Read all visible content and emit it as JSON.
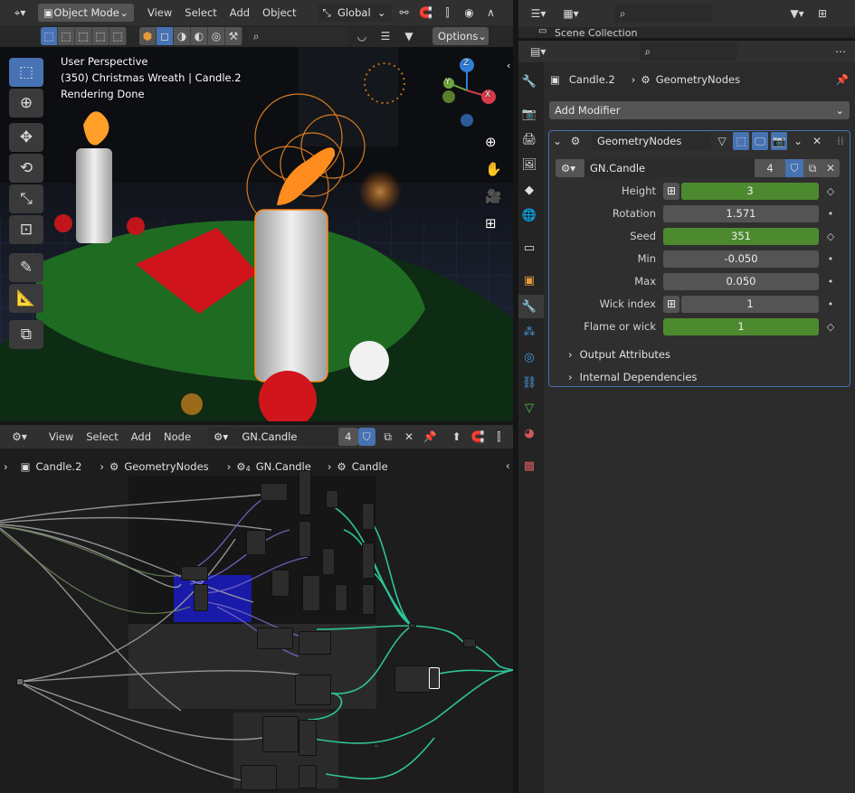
{
  "viewport_header": {
    "mode_label": "Object Mode",
    "menus": [
      "View",
      "Select",
      "Add",
      "Object"
    ],
    "transform_label": "Global",
    "options_label": "Options"
  },
  "viewport_overlay": {
    "perspective": "User Perspective",
    "scene_info": "(350) Christmas Wreath | Candle.2",
    "status": "Rendering Done",
    "axes": {
      "z": "Z",
      "y": "Y",
      "x": "X"
    }
  },
  "node_editor_header": {
    "menus": [
      "View",
      "Select",
      "Add",
      "Node"
    ],
    "node_group": "GN.Candle",
    "users": "4"
  },
  "breadcrumb": [
    "Candle.2",
    "GeometryNodes",
    "GN.Candle",
    "Candle"
  ],
  "node_editor_sub": {
    "users_small": "4"
  },
  "outliner": {
    "title": "Scene Collection"
  },
  "properties": {
    "object_name": "Candle.2",
    "modifier_name_path": "GeometryNodes",
    "add_modifier": "Add Modifier",
    "modifier": {
      "name": "GeometryNodes",
      "node_group": "GN.Candle",
      "users": "4",
      "inputs": [
        {
          "label": "Height",
          "value": "3",
          "style": "green",
          "attr": true,
          "kf": "◇"
        },
        {
          "label": "Rotation",
          "value": "1.571",
          "style": "grey",
          "attr": false,
          "kf": "•"
        },
        {
          "label": "Seed",
          "value": "351",
          "style": "green",
          "attr": false,
          "kf": "◇"
        },
        {
          "label": "Min",
          "value": "-0.050",
          "style": "grey",
          "attr": false,
          "kf": "•"
        },
        {
          "label": "Max",
          "value": "0.050",
          "style": "grey",
          "attr": false,
          "kf": "•"
        },
        {
          "label": "Wick index",
          "value": "1",
          "style": "grey",
          "attr": true,
          "kf": "•"
        },
        {
          "label": "Flame or wick",
          "value": "1",
          "style": "green",
          "attr": false,
          "kf": "◇"
        }
      ],
      "panels": [
        "Output Attributes",
        "Internal Dependencies"
      ]
    }
  },
  "colors": {
    "accent": "#4772b3",
    "green_field": "#4d8a2f",
    "modifier_outline": "#4772b3",
    "node_link": "#2ec49a"
  }
}
